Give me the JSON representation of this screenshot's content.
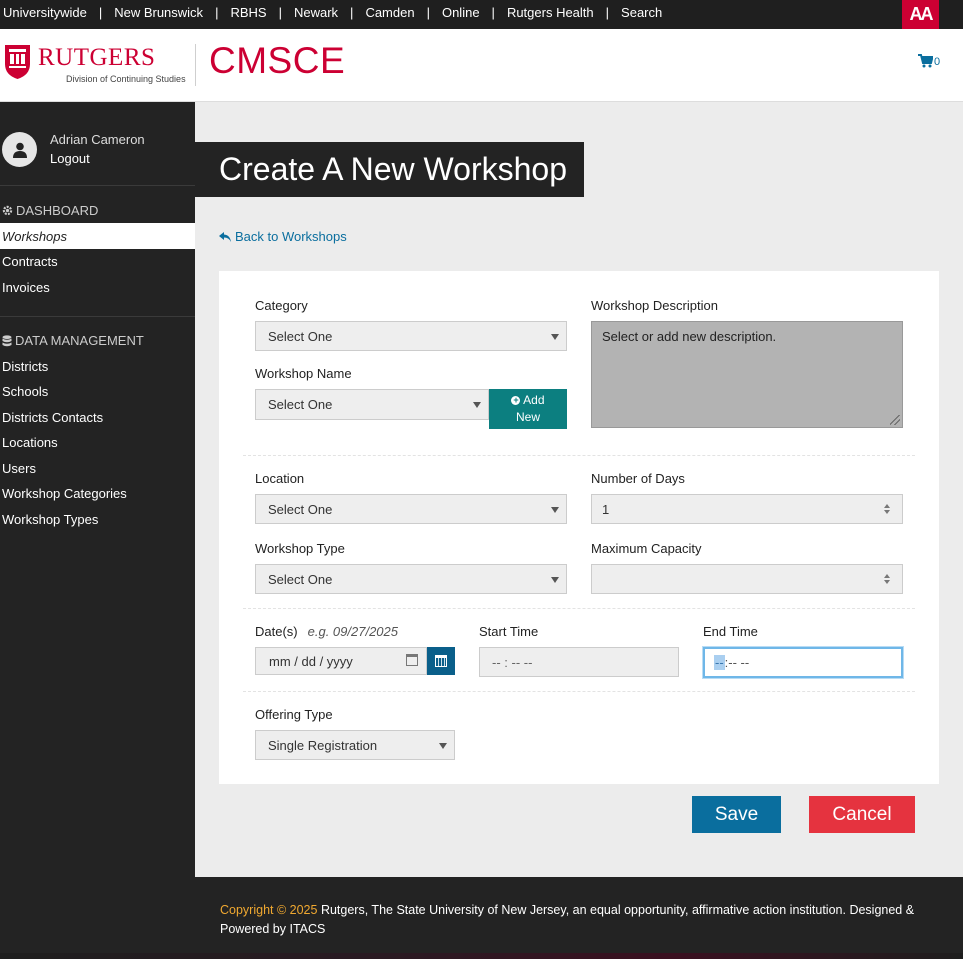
{
  "topbar": {
    "links": [
      "Universitywide",
      "New Brunswick",
      "RBHS",
      "Newark",
      "Camden",
      "Online",
      "Rutgers Health",
      "Search"
    ],
    "separator": "|",
    "a11y_label": "AA"
  },
  "header": {
    "brand_name": "RUTGERS",
    "brand_sub": "Division of Continuing Studies",
    "site_name": "CMSCE",
    "cart_count": "0"
  },
  "sidebar": {
    "user_name": "Adrian Cameron",
    "logout": "Logout",
    "dashboard_head": "DASHBOARD",
    "dashboard_items": [
      "Workshops",
      "Contracts",
      "Invoices"
    ],
    "data_head": "DATA MANAGEMENT",
    "data_items": [
      "Districts",
      "Schools",
      "Districts Contacts",
      "Locations",
      "Users",
      "Workshop Categories",
      "Workshop Types"
    ]
  },
  "main": {
    "title": "Create A New Workshop",
    "back_link": "Back to Workshops"
  },
  "form": {
    "category_label": "Category",
    "category_value": "Select One",
    "workshop_name_label": "Workshop Name",
    "workshop_name_value": "Select One",
    "add_new_line1": "Add",
    "add_new_line2": "New",
    "description_label": "Workshop Description",
    "description_placeholder": "Select or add new description.",
    "location_label": "Location",
    "location_value": "Select One",
    "days_label": "Number of Days",
    "days_value": "1",
    "type_label": "Workshop Type",
    "type_value": "Select One",
    "capacity_label": "Maximum Capacity",
    "capacity_value": "",
    "dates_label": "Date(s)",
    "dates_hint": "e.g. 09/27/2025",
    "date_placeholder": "mm / dd / yyyy",
    "start_label": "Start Time",
    "start_value": "-- : --  --",
    "end_label": "End Time",
    "end_value_hl": "--",
    "end_value_rest": ":--  --",
    "offering_label": "Offering Type",
    "offering_value": "Single Registration"
  },
  "actions": {
    "save": "Save",
    "cancel": "Cancel"
  },
  "footer": {
    "copyright": "Copyright © 2025",
    "text": " Rutgers, The State University of New Jersey, an equal opportunity, affirmative action institution. Designed & Powered by ITACS"
  },
  "colors": {
    "brand_red": "#cc0033",
    "link_blue": "#0a6e9e",
    "teal": "#0c7f80",
    "cancel_red": "#e5333f",
    "footer_accent": "#f0a830"
  }
}
